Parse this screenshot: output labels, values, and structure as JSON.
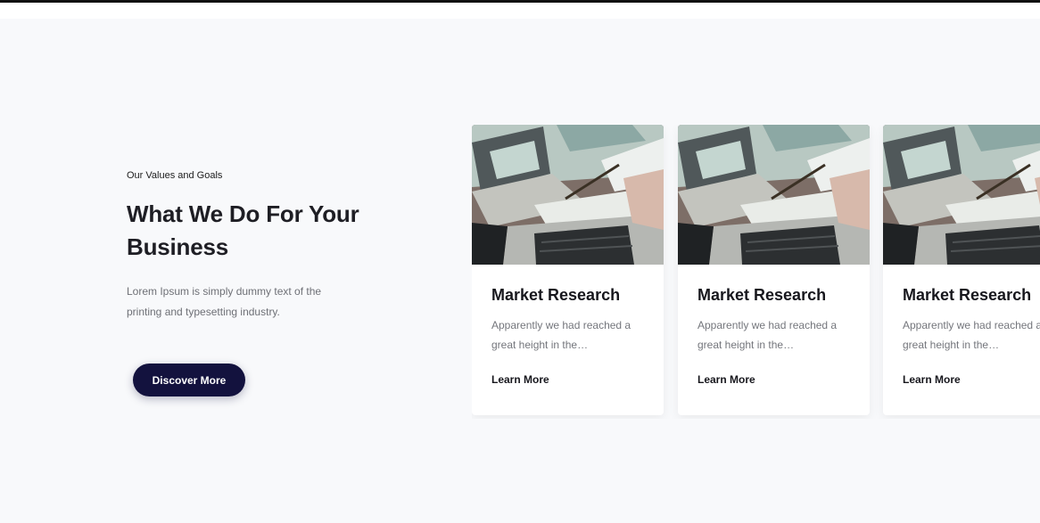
{
  "section": {
    "eyebrow": "Our Values and Goals",
    "headline": "What We Do For Your Business",
    "lead": "Lorem Ipsum is simply dummy text of the printing and typesetting industry.",
    "cta_label": "Discover More"
  },
  "cards": [
    {
      "image": "laptop-desk-photo",
      "title": "Market Research",
      "text": "Apparently we had reached a great height in the…",
      "link": "Learn More"
    },
    {
      "image": "laptop-desk-photo",
      "title": "Market Research",
      "text": "Apparently we had reached a great height in the…",
      "link": "Learn More"
    },
    {
      "image": "laptop-desk-photo",
      "title": "Market Research",
      "text": "Apparently we had reached a great height in the…",
      "link": "Learn More"
    }
  ],
  "colors": {
    "page_background": "#f8f9fb",
    "button_background": "#13123e",
    "heading": "#1e1e24",
    "body_text": "#6e7076"
  }
}
